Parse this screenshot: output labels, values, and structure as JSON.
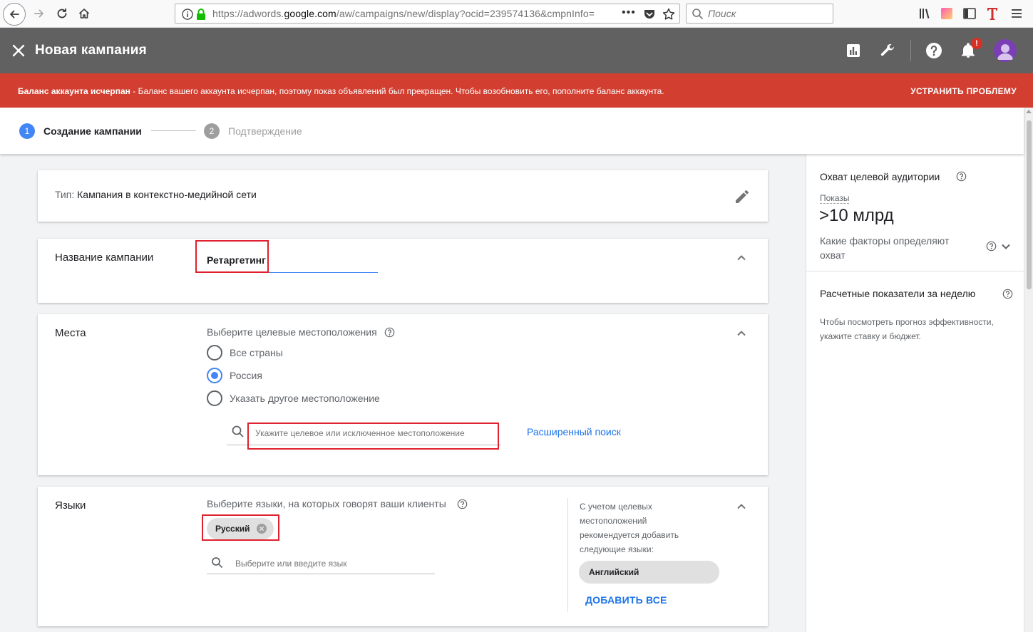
{
  "browser": {
    "url_prefix": "https://adwords.",
    "url_domain": "google.com",
    "url_path": "/aw/campaigns/new/display?ocid=239574136&cmpnInfo=",
    "search_placeholder": "Поиск",
    "overflow_dots": "•••"
  },
  "header": {
    "title": "Новая кампания",
    "notif_badge": "!"
  },
  "alert": {
    "bold": "Баланс аккаунта исчерпан",
    "text": " - Баланс вашего аккаунта исчерпан, поэтому показ объявлений был прекращен. Чтобы возобновить его, пополните баланс аккаунта.",
    "action": "УСТРАНИТЬ ПРОБЛЕМУ",
    "color": "#d23f31"
  },
  "stepper": {
    "step1_num": "1",
    "step1_label": "Создание кампании",
    "step2_num": "2",
    "step2_label": "Подтверждение"
  },
  "type_card": {
    "label": "Тип:",
    "value": " Кампания в контекстно-медийной сети"
  },
  "name_card": {
    "label": "Название кампании",
    "value": "Ретаргетинг"
  },
  "places_card": {
    "label": "Места",
    "sublabel": "Выберите целевые местоположения",
    "options": [
      {
        "label": "Все страны",
        "checked": false
      },
      {
        "label": "Россия",
        "checked": true
      },
      {
        "label": "Указать другое местоположение",
        "checked": false
      }
    ],
    "search_placeholder": "Укажите целевое или исключенное местоположение",
    "advanced_link": "Расширенный поиск"
  },
  "lang_card": {
    "label": "Языки",
    "sublabel": "Выберите языки, на которых говорят ваши клиенты",
    "selected_chip": "Русский",
    "search_placeholder": "Выберите или введите язык",
    "suggest_text": "С учетом целевых местоположений рекомендуется добавить следующие языки:",
    "suggest_chip": "Английский",
    "add_all": "ДОБАВИТЬ ВСЕ"
  },
  "right_panel": {
    "reach_title": "Охват целевой аудитории",
    "impressions_label": "Показы",
    "impressions_value": ">10 млрд",
    "factors_label": "Какие факторы определяют охват",
    "weekly_title": "Расчетные показатели за неделю",
    "weekly_text": "Чтобы посмотреть прогноз эффективности, укажите ставку и бюджет."
  },
  "colors": {
    "accent_blue": "#4285f4",
    "link_blue": "#1a73e8",
    "header_gray": "#616161",
    "highlight_red": "#e0202e"
  }
}
